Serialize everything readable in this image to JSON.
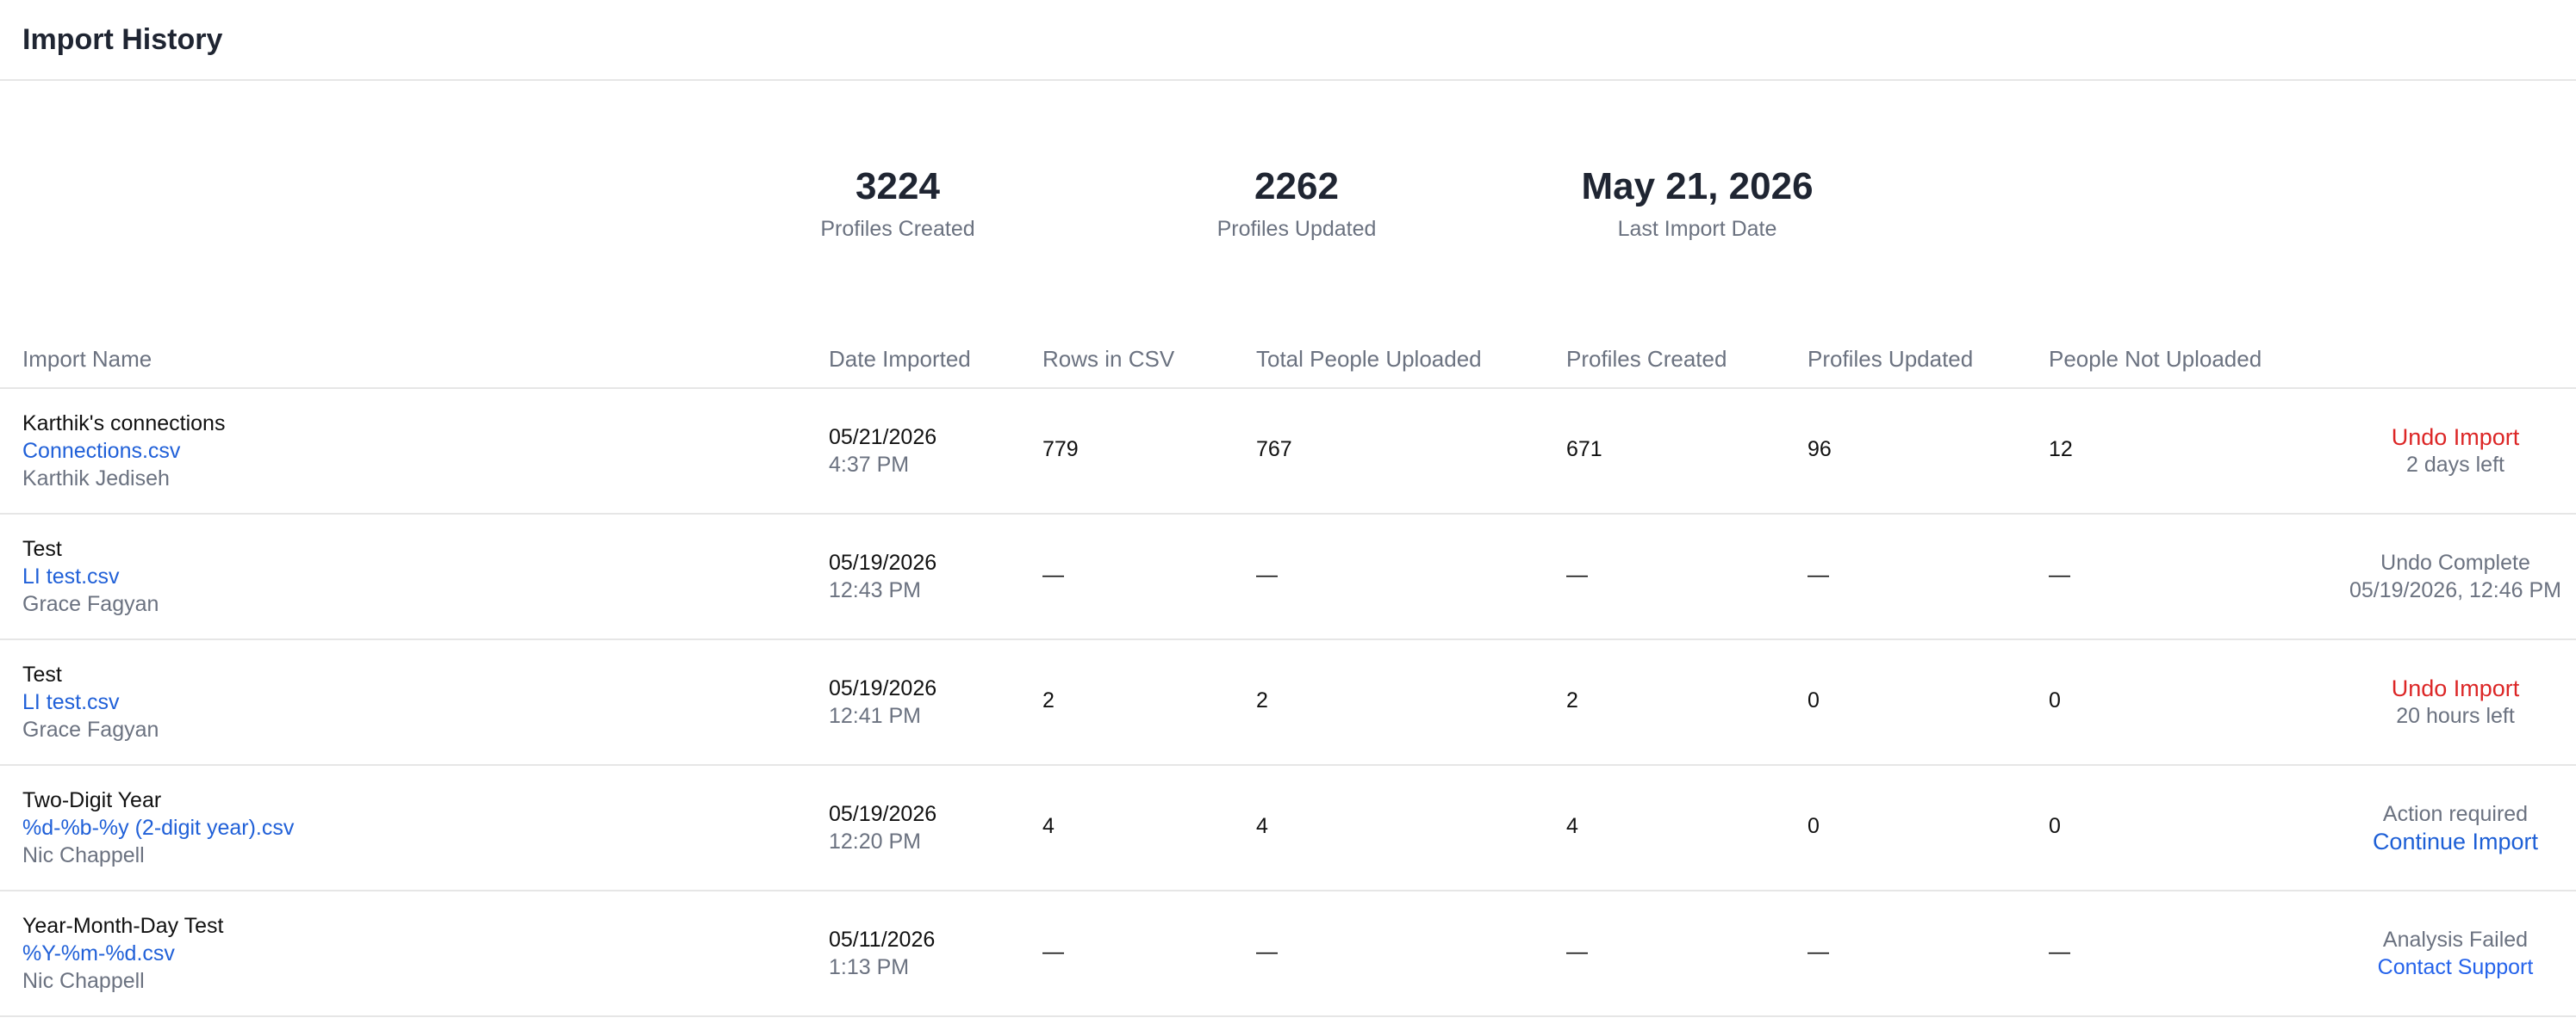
{
  "page": {
    "title": "Import History"
  },
  "stats": [
    {
      "value": "3224",
      "label": "Profiles Created"
    },
    {
      "value": "2262",
      "label": "Profiles Updated"
    },
    {
      "value": "May 21, 2026",
      "label": "Last Import Date"
    }
  ],
  "table": {
    "headers": [
      "Import Name",
      "Date Imported",
      "Rows in CSV",
      "Total People Uploaded",
      "Profiles Created",
      "Profiles Updated",
      "People Not Uploaded"
    ],
    "rows": [
      {
        "name": "Karthik's connections",
        "file": "Connections.csv",
        "user": "Karthik Jediseh",
        "date": "05/21/2026",
        "time": "4:37 PM",
        "rows": "779",
        "total": "767",
        "created": "671",
        "updated": "96",
        "not_uploaded": "12",
        "action_primary": "Undo Import",
        "action_secondary": "2 days left"
      },
      {
        "name": "Test",
        "file": "LI test.csv",
        "user": "Grace Fagyan",
        "date": "05/19/2026",
        "time": "12:43 PM",
        "rows": "—",
        "total": "—",
        "created": "—",
        "updated": "—",
        "not_uploaded": "—",
        "status_line1": "Undo Complete",
        "status_line2": "05/19/2026, 12:46 PM"
      },
      {
        "name": "Test",
        "file": "LI test.csv",
        "user": "Grace Fagyan",
        "date": "05/19/2026",
        "time": "12:41 PM",
        "rows": "2",
        "total": "2",
        "created": "2",
        "updated": "0",
        "not_uploaded": "0",
        "action_primary": "Undo Import",
        "action_secondary": "20 hours left"
      },
      {
        "name": "Two-Digit Year",
        "file": "%d-%b-%y (2-digit year).csv",
        "user": "Nic Chappell",
        "date": "05/19/2026",
        "time": "12:20 PM",
        "rows": "4",
        "total": "4",
        "created": "4",
        "updated": "0",
        "not_uploaded": "0",
        "status_line1": "Action required",
        "action_link": "Continue Import"
      },
      {
        "name": "Year-Month-Day Test",
        "file": "%Y-%m-%d.csv",
        "user": "Nic Chappell",
        "date": "05/11/2026",
        "time": "1:13 PM",
        "rows": "—",
        "total": "—",
        "created": "—",
        "updated": "—",
        "not_uploaded": "—",
        "status_line1": "Analysis Failed",
        "action_link": "Contact Support"
      }
    ]
  },
  "colors": {
    "accent_red": "#dc2626",
    "link_blue": "#2060d8",
    "muted_text": "#6b7280",
    "divider": "#e6e6e6"
  }
}
